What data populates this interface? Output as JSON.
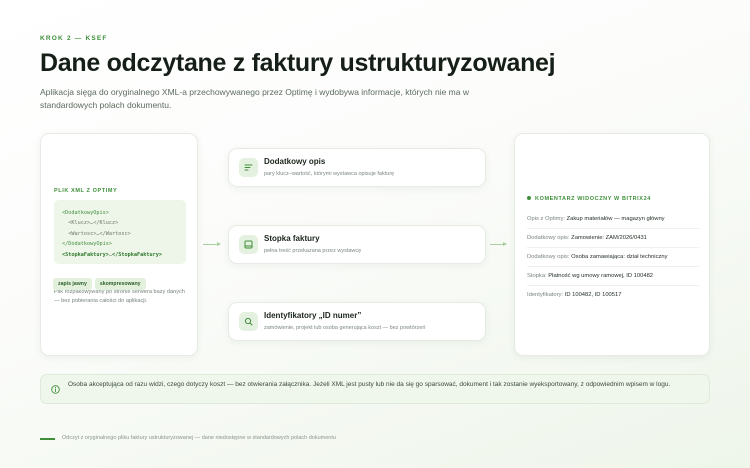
{
  "header": {
    "eyebrow": "KROK 2 — KSEF",
    "title": "Dane odczytane z faktury ustrukturyzowanej",
    "subtitle": "Aplikacja sięga do oryginalnego XML-a przechowywanego przez Optimę i wydobywa informacje, których nie ma w standardowych polach dokumentu."
  },
  "source": {
    "label": "PLIK XML Z OPTIMY",
    "code": {
      "l1": "<DodatkowyOpis>",
      "l2": "<Klucz>…</Klucz>",
      "l3": "<Wartosc>…</Wartosc>",
      "l4": "</DodatkowyOpis>",
      "l5_open": "<StopkaFaktury>",
      "l5_mid": "…",
      "l5_close": "</StopkaFaktury>"
    },
    "badges": [
      "zapis jawny",
      "skompresowany"
    ],
    "note": "Plik rozpakowywany po stronie serwera bazy danych — bez pobierania całości do aplikacji."
  },
  "extracted": [
    {
      "title": "Dodatkowy opis",
      "desc": "pary klucz–wartość, którymi wystawca opisuje fakturę",
      "icon": "lines-icon"
    },
    {
      "title": "Stopka faktury",
      "desc": "pełna treść przekazana przez wystawcę",
      "icon": "document-footer-icon"
    },
    {
      "title": "Identyfikatory „ID numer”",
      "desc": "zamówienie, projekt lub osoba generująca koszt — bez powtórzeń",
      "icon": "search-icon"
    }
  ],
  "comment": {
    "label": "KOMENTARZ WIDOCZNY W BITRIX24",
    "rows": [
      {
        "key": "Opis z Optimy:",
        "value": "Zakup materiałów — magazyn główny"
      },
      {
        "key": "Dodatkowy opis:",
        "value": "Zamowienie: ZAM/2026/0431"
      },
      {
        "key": "Dodatkowy opis:",
        "value": "Osoba zamawiająca: dział techniczny"
      },
      {
        "key": "Stopka:",
        "value": "Płatność wg umowy ramowej, ID 100482"
      },
      {
        "key": "Identyfikatory:",
        "value": "ID 100482, ID 100517"
      }
    ]
  },
  "info": {
    "text": "Osoba akceptująca od razu widzi, czego dotyczy koszt — bez otwierania załącznika. Jeżeli XML jest pusty lub nie da się go sparsować, dokument i tak zostanie wyeksportowany, z odpowiednim wpisem w logu."
  },
  "footer": {
    "text": "Odczyt z oryginalnego pliku faktury ustrukturyzowanej — dane niedostępne w standardowych polach dokumentu"
  },
  "colors": {
    "accent": "#3f8f3a",
    "accent_soft": "#eef6ea"
  }
}
